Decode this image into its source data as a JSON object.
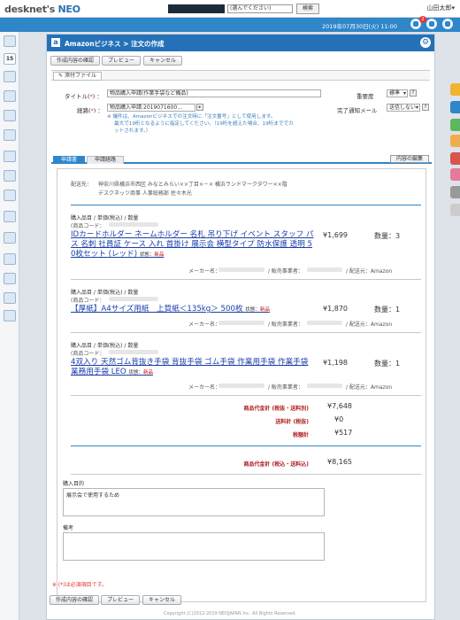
{
  "app": {
    "logo_text": "desknet's",
    "logo_neo": "NEO",
    "user": "山田太郎▾",
    "date": "2019年07月30日(火) 11:00",
    "notification_count": "2"
  },
  "topsearch": {
    "select_value": "(選んでください)",
    "button": "検索"
  },
  "left_icons": [
    "portal-icon",
    "calendar-icon",
    "schedule-icon",
    "mail-icon",
    "workflow-icon",
    "document-icon",
    "report-icon",
    "project-icon",
    "news-icon",
    "folder-icon",
    "box-icon",
    "user-icon",
    "help-icon",
    "info-icon"
  ],
  "calendar_day": "15",
  "right_tabs": [
    "#f2b232",
    "#2f86c9",
    "#5cb85c",
    "#f0ad4e",
    "#d9534f",
    "#e67a9b",
    "#999999",
    "#cccccc"
  ],
  "header": {
    "title": "Amazonビジネス > 注文の作成",
    "logo_letter": "a"
  },
  "buttons": {
    "confirm": "作成内容の確認",
    "preview": "プレビュー",
    "cancel": "キャンセル"
  },
  "attach": {
    "label": "添付ファイル"
  },
  "form": {
    "title_label": "タイトル(",
    "title_req": "*",
    "title_label_end": ")",
    "title_value": "物品購入申請(作業手袋など備品)",
    "route_label": "経路(",
    "route_value": "物品購入申請:2019071600…",
    "priority_label": "重要度",
    "priority_value": "標準",
    "notify_label": "完了通知メール",
    "notify_value": "送信しない",
    "note_lines": [
      "※ 議件は、Amazonビジネスでの注文時に「注文番号」として使用します。",
      "最大で19桁となるように指定してください。（19桁を超えた場合、19桁まででカ",
      "ットされます。）"
    ]
  },
  "tabs": {
    "request": "申請書",
    "route": "申請経路",
    "edit": "内容の編集"
  },
  "doc": {
    "ship_label": "配送先：",
    "ship_address": "神奈川県横浜市西区 みなとみらい××丁目×－× 横浜ランドマークタワー××階",
    "ship_company": "デスクネッツ商事 人事総務部 佐々木光",
    "item_header": "購入品目 / 単価(税込) / 数量",
    "product_code": "(商品コード：",
    "maker_label": "メーカー名：",
    "seller_label": "/ 販売事業者：",
    "delivery_label": "/ 配送元：Amazon",
    "cond_label": "状態：",
    "cond_value": "新品",
    "items": [
      {
        "name_lines": [
          "IDカードホルダー ネームホルダー 名札 吊り下げ イベント スタッフ パ",
          "ス 名刺 社員証 ケース 入れ 首掛け 展示会 横型タイプ 防水保護 透明 5",
          "0枚セット (レッド)"
        ],
        "price": "¥1,699",
        "qty": "数量：3"
      },
      {
        "name_lines": [
          "【厚紙】A4サイズ用紙　上質紙＜135kg＞ 500枚"
        ],
        "price": "¥1,870",
        "qty": "数量：1"
      },
      {
        "name_lines": [
          "4双入り 天然ゴム背抜き手袋 背抜手袋 ゴム手袋 作業用手袋 作業手袋",
          "業務用手袋 LEO"
        ],
        "price": "¥1,198",
        "qty": "数量：1"
      }
    ],
    "subtotal_label": "商品代金計 (税抜・送料別)",
    "subtotal": "¥7,648",
    "shipping_label": "送料計 (税抜)",
    "shipping": "¥0",
    "tax_label": "税額計",
    "tax": "¥517",
    "total_label": "商品代金計 (税込・送料込)",
    "total": "¥8,165",
    "purpose_label": "購入目的",
    "purpose_value": "展示会で使用するため",
    "remarks_label": "備考",
    "remarks_value": ""
  },
  "required_note": "※ (*)は必須項目です。",
  "footer": "Copyright (C)2012-2019 NEOJAPAN Inc. All Rights Reserved."
}
